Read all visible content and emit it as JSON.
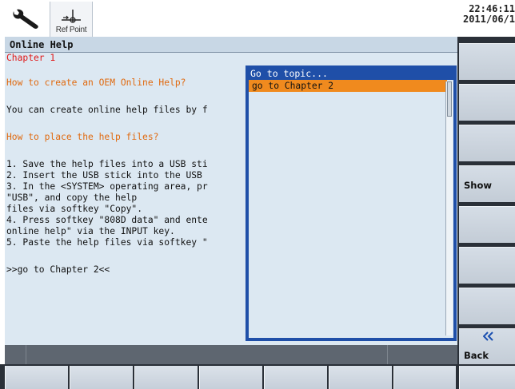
{
  "header": {
    "tool_icon": "wrench-icon",
    "refpoint_icon": "reference-point-icon",
    "refpoint_label": "Ref Point",
    "time": "22:46:11",
    "date": "2011/06/1"
  },
  "panel": {
    "title": "Online Help",
    "lines": [
      "Chapter 1",
      "How to create an OEM Online Help?",
      "You can create online help files by f",
      "How to place the help files?",
      "1. Save the help files into a USB sti",
      "2. Insert the USB stick into the USB",
      "3. In the <SYSTEM> operating area, pr",
      "\"USB\", and copy the help",
      "files via softkey \"Copy\".",
      "4. Press softkey \"808D data\" and ente",
      "online help\" via the INPUT key.",
      "5. Paste the help files via softkey \"",
      ">>go to Chapter 2<<"
    ]
  },
  "popup": {
    "title": "Go to topic...",
    "items": [
      "go to Chapter 2"
    ]
  },
  "softkeys": {
    "show": "Show",
    "back": "Back",
    "back_icon": "double-chevron-left-icon"
  },
  "colors": {
    "heading_red": "#e01818",
    "heading_orange": "#e06a10",
    "content_bg": "#dce8f2",
    "popup_border": "#1f4fa8",
    "selection": "#f08a1e"
  }
}
